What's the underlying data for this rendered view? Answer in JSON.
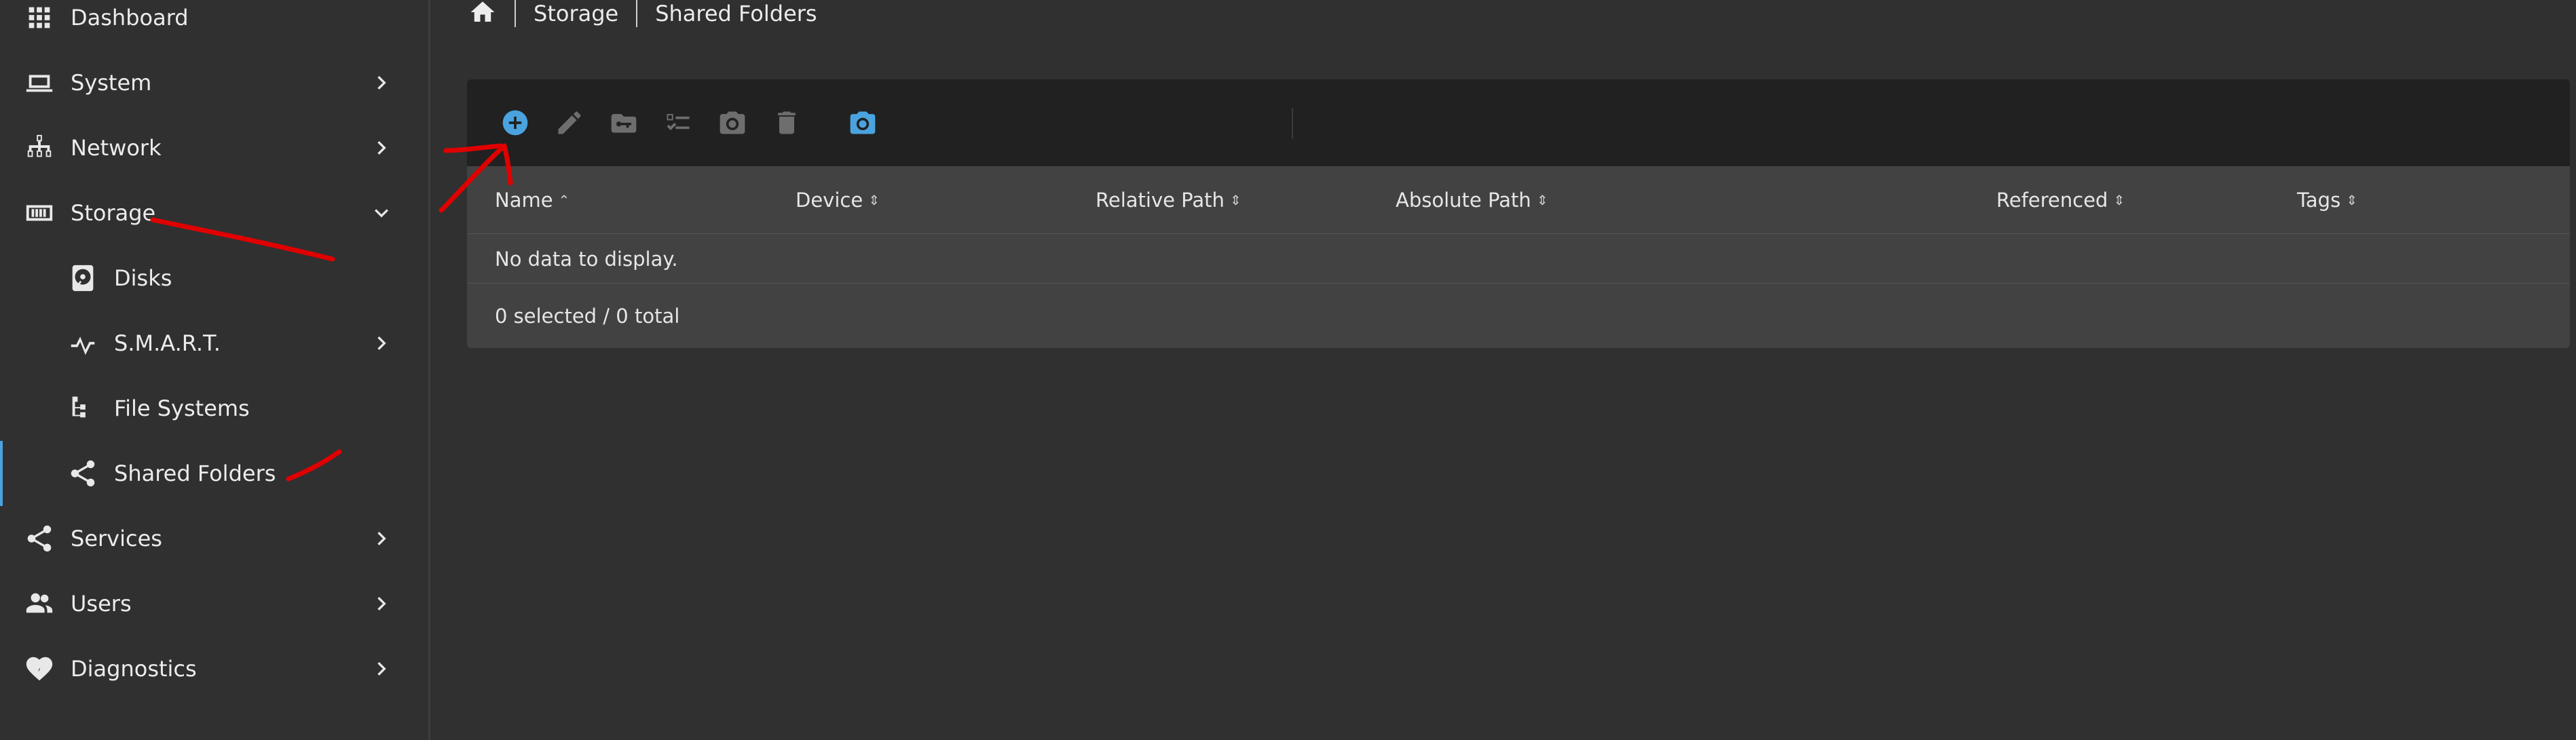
{
  "sidebar": {
    "items": [
      {
        "label": "Dashboard",
        "icon": "apps-grid-icon"
      },
      {
        "label": "System",
        "icon": "laptop-icon",
        "chevron": "chevron-right"
      },
      {
        "label": "Network",
        "icon": "network-icon",
        "chevron": "chevron-right"
      },
      {
        "label": "Storage",
        "icon": "storage-icon",
        "chevron": "chevron-down",
        "expanded": true
      },
      {
        "label": "Disks",
        "icon": "harddisk-icon",
        "sub": true
      },
      {
        "label": "S.M.A.R.T.",
        "icon": "pulse-icon",
        "sub": true,
        "chevron": "chevron-right"
      },
      {
        "label": "File Systems",
        "icon": "file-tree-icon",
        "sub": true
      },
      {
        "label": "Shared Folders",
        "icon": "share-icon",
        "sub": true,
        "active": true
      },
      {
        "label": "Services",
        "icon": "share-icon",
        "chevron": "chevron-right"
      },
      {
        "label": "Users",
        "icon": "users-icon",
        "chevron": "chevron-right"
      },
      {
        "label": "Diagnostics",
        "icon": "heart-pulse-icon",
        "chevron": "chevron-right"
      }
    ]
  },
  "breadcrumb": {
    "items": [
      "Storage",
      "Shared Folders"
    ]
  },
  "toolbar": {
    "buttons": [
      {
        "name": "add-button",
        "icon": "plus-circle-icon",
        "enabled": true
      },
      {
        "name": "edit-button",
        "icon": "pencil-icon",
        "enabled": false
      },
      {
        "name": "privileges-button",
        "icon": "folder-key-icon",
        "enabled": false
      },
      {
        "name": "acl-button",
        "icon": "checklist-icon",
        "enabled": false
      },
      {
        "name": "snapshot-button",
        "icon": "camera-icon",
        "enabled": false
      },
      {
        "name": "delete-button",
        "icon": "trash-icon",
        "enabled": false
      },
      {
        "name": "snapshots-button",
        "icon": "camera-icon",
        "enabled": true
      }
    ],
    "search": {
      "value": "",
      "placeholder": ""
    }
  },
  "table": {
    "columns": [
      "Name",
      "Device",
      "Relative Path",
      "Absolute Path",
      "Referenced",
      "Tags"
    ],
    "sorted_column": "Name",
    "empty_message": "No data to display.",
    "footer": "0 selected / 0 total"
  },
  "colors": {
    "accent": "#4aa3df",
    "background": "#303030",
    "panel": "#424242",
    "toolbar": "#212121",
    "annotation": "#e00000"
  }
}
